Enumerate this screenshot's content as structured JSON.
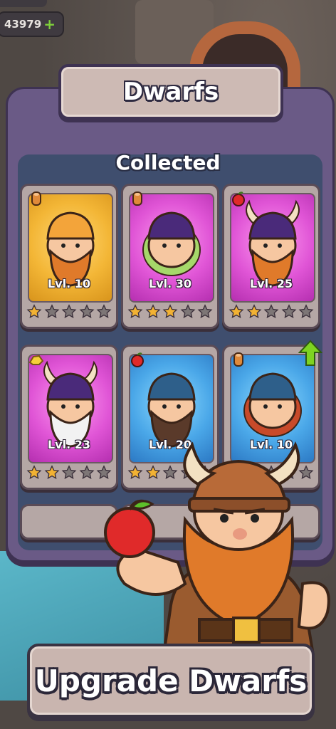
{
  "currency": {
    "amount": "43979",
    "add_icon": "plus-icon"
  },
  "panel": {
    "title": "Dwarfs",
    "section": "Collected"
  },
  "dwarfs": [
    {
      "level": "Lvl. 10",
      "stars": 1,
      "rarity": "gold",
      "resource_icon": "wood-log-icon",
      "upgradable": false
    },
    {
      "level": "Lvl. 30",
      "stars": 3,
      "rarity": "pink",
      "resource_icon": "wood-log-icon",
      "upgradable": false
    },
    {
      "level": "Lvl. 25",
      "stars": 2,
      "rarity": "pink",
      "resource_icon": "apple-icon",
      "upgradable": false
    },
    {
      "level": "Lvl. 23",
      "stars": 2,
      "rarity": "pink",
      "resource_icon": "gold-nugget-icon",
      "upgradable": false
    },
    {
      "level": "Lvl. 20",
      "stars": 2,
      "rarity": "blue",
      "resource_icon": "apple-icon",
      "upgradable": false
    },
    {
      "level": "Lvl. 10",
      "stars": 2,
      "rarity": "blue",
      "resource_icon": "wood-log-icon",
      "upgradable": true
    }
  ],
  "max_stars": 5,
  "cta": {
    "label": "Upgrade Dwarfs"
  },
  "colors": {
    "star_filled": "#f2b233",
    "star_empty": "#7d7676",
    "upgrade_arrow": "#7ed321",
    "panel": "#6a5a86"
  }
}
